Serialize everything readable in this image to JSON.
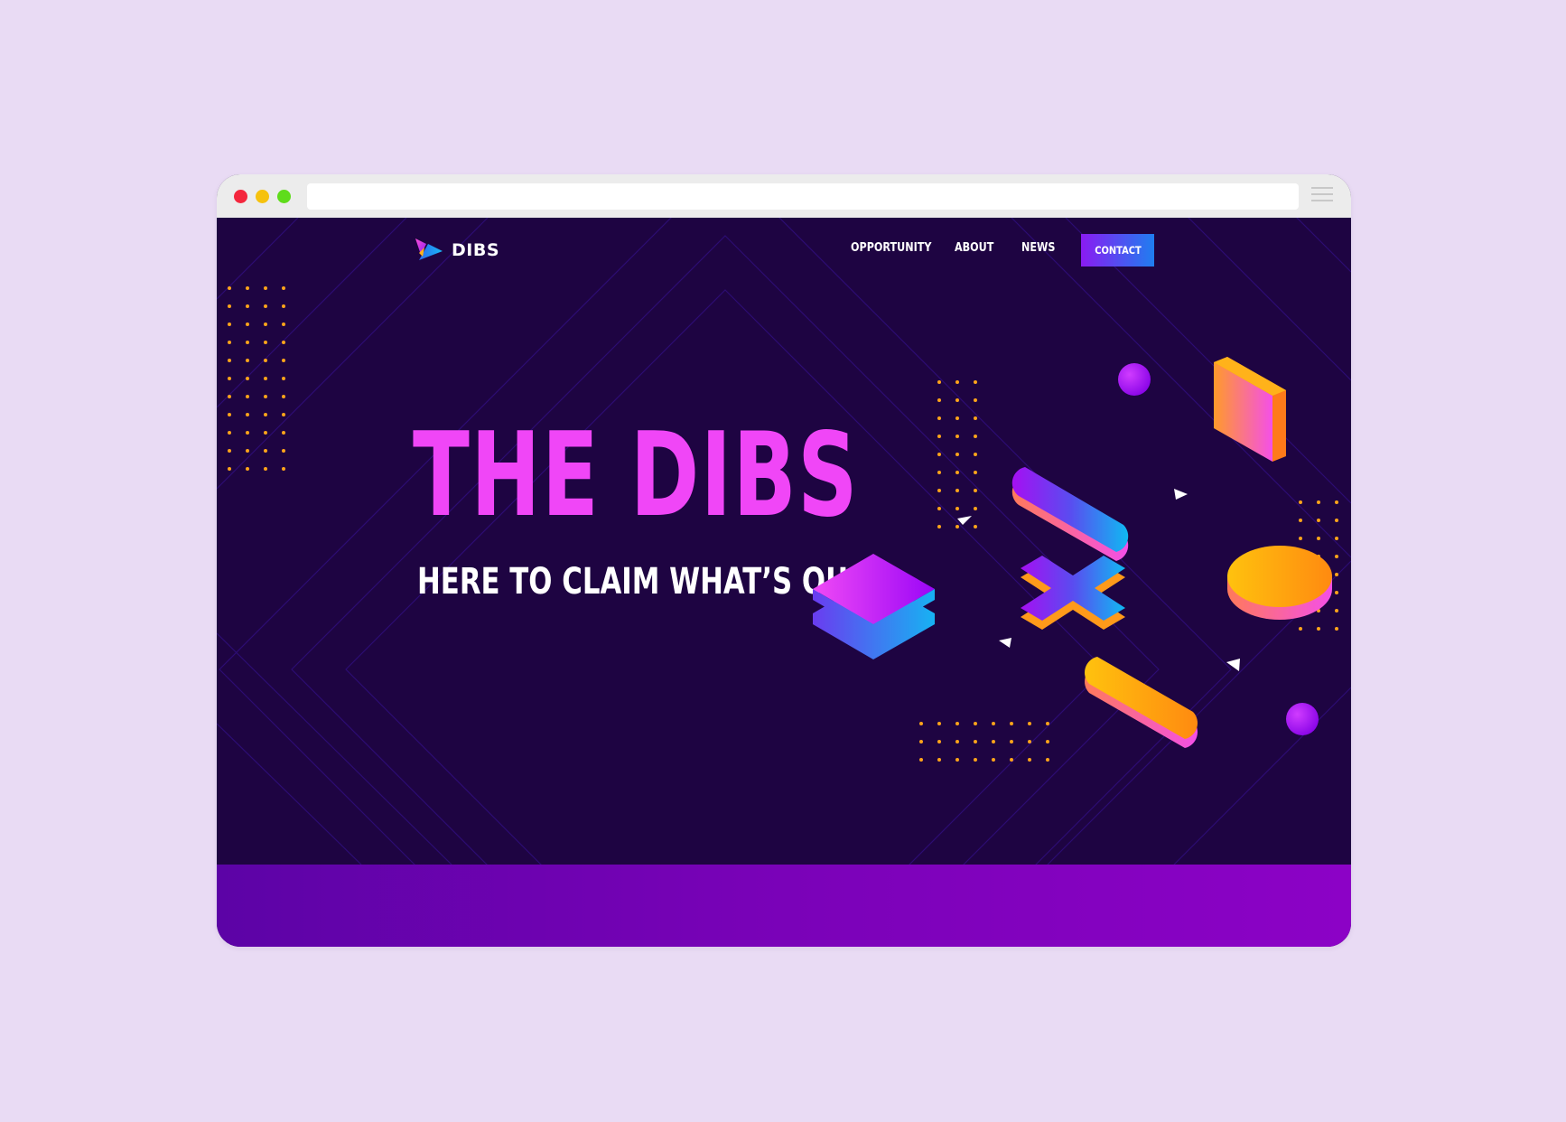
{
  "window": {
    "controls": [
      "close",
      "minimize",
      "maximize"
    ],
    "url": "",
    "menu_icon": "hamburger-menu-icon"
  },
  "brand": {
    "name": "DIBS",
    "logo_icon": "dibs-logo-icon"
  },
  "nav": {
    "items": [
      {
        "label": "OPPORTUNITY"
      },
      {
        "label": "ABOUT"
      },
      {
        "label": "NEWS"
      }
    ],
    "cta_label": "CONTACT"
  },
  "hero": {
    "title": "THE DIBS",
    "subtitle": "HERE TO CLAIM WHAT’S OURS."
  },
  "colors": {
    "page_background": "#e9dbf4",
    "hero_background": "#1e0442",
    "title_pink": "#f046f7",
    "accent_purple": "#8a1bf2",
    "accent_blue": "#1f7ef0",
    "accent_orange": "#ffa81a",
    "footer_purple": "#7a02b8"
  }
}
